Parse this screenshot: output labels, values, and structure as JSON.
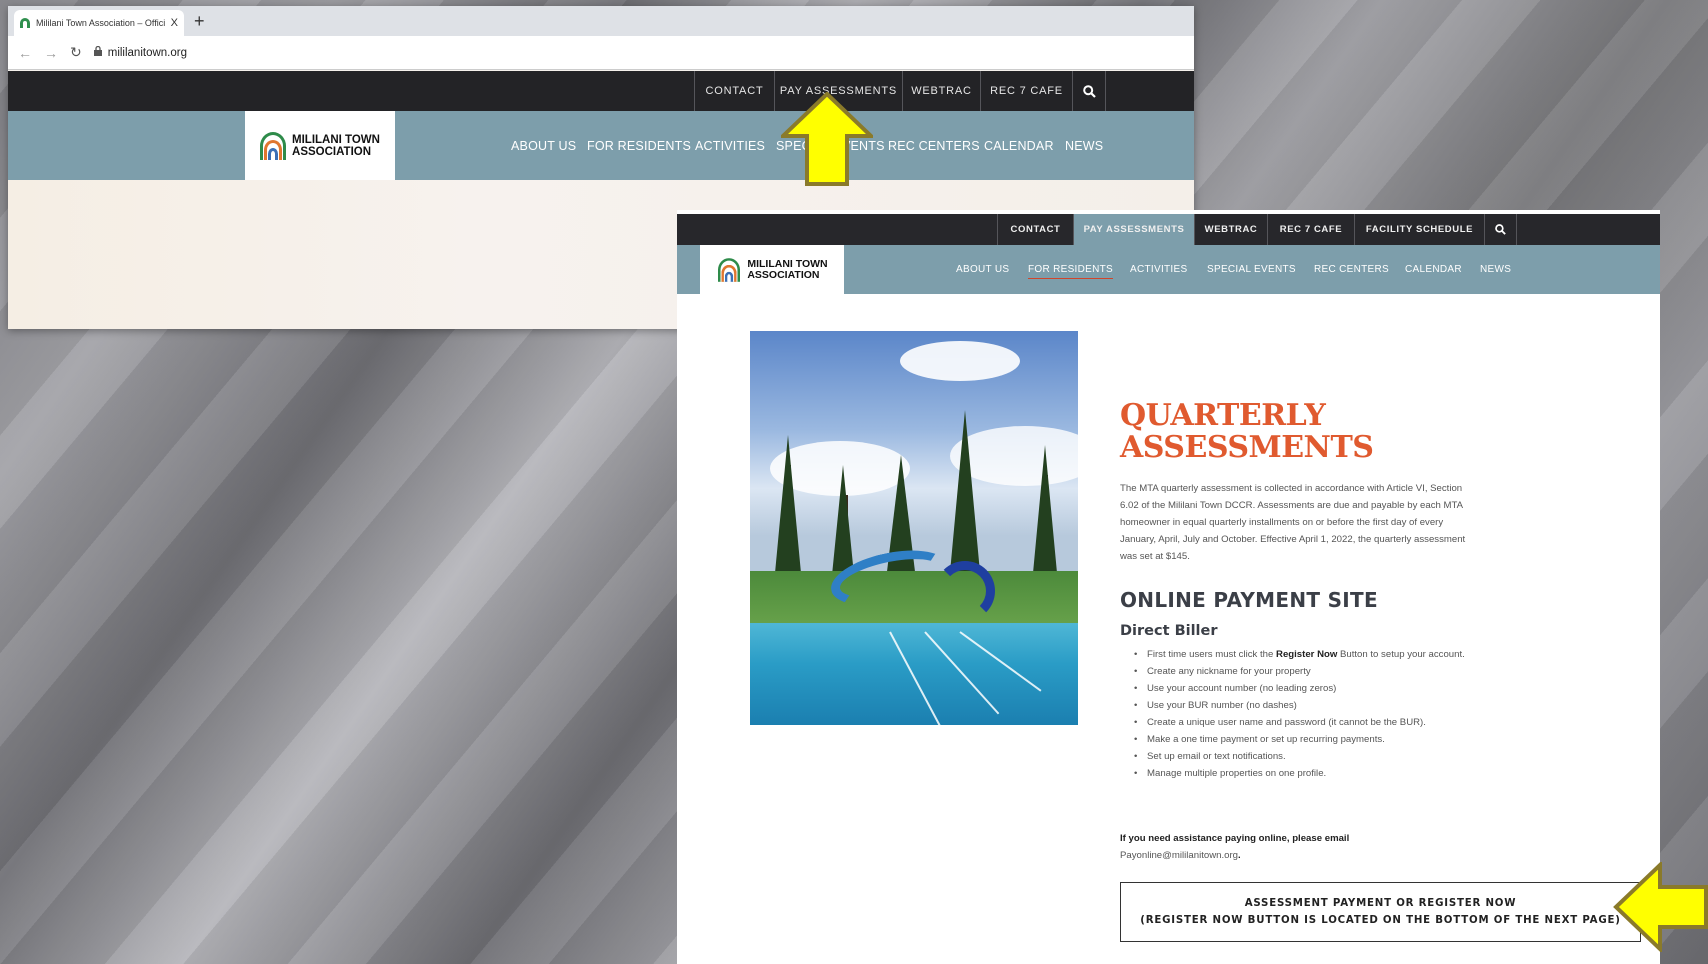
{
  "browser": {
    "tab_title": "Mililani Town Association – Official S",
    "tab_close": "X",
    "new_tab": "+",
    "url": "mililanitown.org"
  },
  "utility_nav_1": [
    "CONTACT",
    "PAY ASSESSMENTS",
    "WEBTRAC",
    "REC 7 CAFE"
  ],
  "utility_nav_2": [
    "CONTACT",
    "PAY ASSESSMENTS",
    "WEBTRAC",
    "REC 7 CAFE",
    "FACILITY SCHEDULE"
  ],
  "logo": {
    "line1": "MILILANI TOWN",
    "line2": "ASSOCIATION"
  },
  "main_nav_1": [
    "ABOUT US",
    "FOR RESIDENTS",
    "ACTIVITIES",
    "SPECIAL EVENTS",
    "REC CENTERS",
    "CALENDAR",
    "NEWS"
  ],
  "main_nav_2": [
    "ABOUT US",
    "FOR RESIDENTS",
    "ACTIVITIES",
    "SPECIAL EVENTS",
    "REC CENTERS",
    "CALENDAR",
    "NEWS"
  ],
  "content": {
    "heading_line1": "QUARTERLY",
    "heading_line2": "ASSESSMENTS",
    "intro": "The MTA quarterly assessment is collected in accordance with Article VI, Section 6.02 of the Mililani Town DCCR. Assessments are due and payable by each MTA homeowner in equal quarterly installments on or before the first day of every January, April, July and October. Effective April 1, 2022, the quarterly assessment was set at $145.",
    "online_title": "ONLINE PAYMENT SITE",
    "biller": "Direct Biller",
    "bullet_first_pre": "First time users must click the ",
    "bullet_first_bold": "Register Now",
    "bullet_first_post": " Button  to setup your account.",
    "bullets": [
      "Create any nickname for your property",
      "Use your account number (no leading zeros)",
      "Use your BUR number (no dashes)",
      "Create a unique user name and password (it cannot be the BUR).",
      "Make a one time payment or set up recurring payments.",
      "Set up email or text notifications.",
      "Manage multiple properties on one profile."
    ],
    "assist_bold": "If you need assistance paying online, please email",
    "assist_email": "Payonline@mililanitown.org",
    "assist_period": ".",
    "cta_line1": "ASSESSMENT PAYMENT OR REGISTER NOW",
    "cta_line2": "(REGISTER NOW BUTTON IS LOCATED ON THE BOTTOM OF THE NEXT PAGE)"
  },
  "icons": {
    "search": "search-icon",
    "back": "back-arrow-icon",
    "forward": "forward-arrow-icon",
    "reload": "reload-icon",
    "lock": "lock-icon"
  },
  "colors": {
    "top_bar": "#232326",
    "nav_bar": "#7d9eab",
    "heading": "#e05a2f",
    "arrow_fill": "#ffff00",
    "arrow_outline": "#8a7a2a"
  }
}
